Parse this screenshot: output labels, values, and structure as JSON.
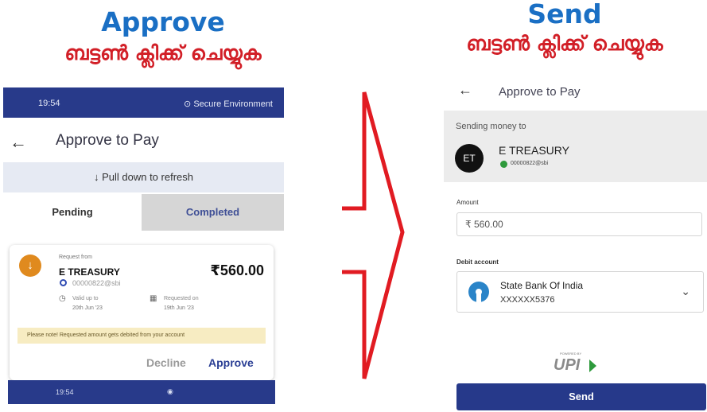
{
  "left_heading": {
    "title": "Approve",
    "subtitle": "ബട്ടൺ ക്ലിക്ക് ചെയ്യുക"
  },
  "right_heading": {
    "title": "Send",
    "subtitle": "ബട്ടൺ ക്ലിക്ക് ചെയ്യുക"
  },
  "left_phone": {
    "status_time": "19:54",
    "status_secure": "Secure Environment",
    "back_icon": "←",
    "title": "Approve to Pay",
    "refresh": "↓ Pull down to refresh",
    "tabs": {
      "pending": "Pending",
      "completed": "Completed"
    },
    "request": {
      "avatar_icon": "↓",
      "from_label": "Request from",
      "payee": "E TREASURY",
      "amount": "₹560.00",
      "vpa": "00000822@sbi",
      "valid_label": "Valid up to",
      "valid_date": "20th Jun '23",
      "requested_label": "Requested on",
      "requested_date": "19th Jun '23",
      "notice": "Please note! Requested amount gets debited from your account",
      "decline": "Decline",
      "approve": "Approve"
    },
    "nav_time": "19:54",
    "nav_icon": "◉"
  },
  "right_phone": {
    "back_icon": "←",
    "title": "Approve to Pay",
    "sending_label": "Sending money to",
    "payee_initials": "ET",
    "payee_name": "E TREASURY",
    "payee_vpa": "00000822@sbi",
    "amount_label": "Amount",
    "amount_value": "₹ 560.00",
    "debit_label": "Debit account",
    "bank_name": "State Bank Of India",
    "account_no": "XXXXXX5376",
    "chevron": "⌄",
    "powered_by": "POWERED BY",
    "upi_logo": "UPI",
    "send": "Send"
  },
  "colors": {
    "title_blue": "#1a6fc4",
    "malayalam_red": "#d21f27",
    "app_navy": "#283a8a",
    "arrow_red": "#e11b22"
  }
}
